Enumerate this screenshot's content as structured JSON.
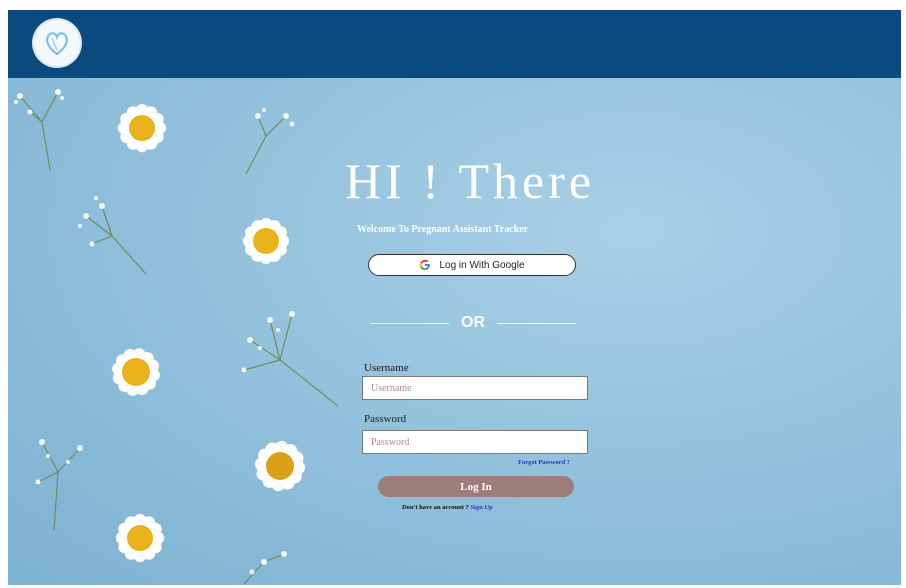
{
  "header": {
    "logo_icon": "heart-logo-icon",
    "bar_color": "#0a4a7f"
  },
  "hero": {
    "title": "HI ! There",
    "subtitle": "Welcome To Pregnant Assistant Tracker"
  },
  "google_login": {
    "label": "Log in With Google",
    "icon": "google-icon"
  },
  "divider": {
    "text": "OR"
  },
  "form": {
    "username_label": "Username",
    "username_placeholder": "Username",
    "username_value": "",
    "password_label": "Password",
    "password_placeholder": "Password",
    "password_value": "",
    "forgot_label": "Forgot Password ?",
    "login_label": "Log In",
    "no_account_text": "Don't have an account ?",
    "signup_label": "Sign Up"
  },
  "colors": {
    "accent_login": "#9d7d79",
    "link": "#2936c8",
    "background": "#8fbfdb"
  }
}
